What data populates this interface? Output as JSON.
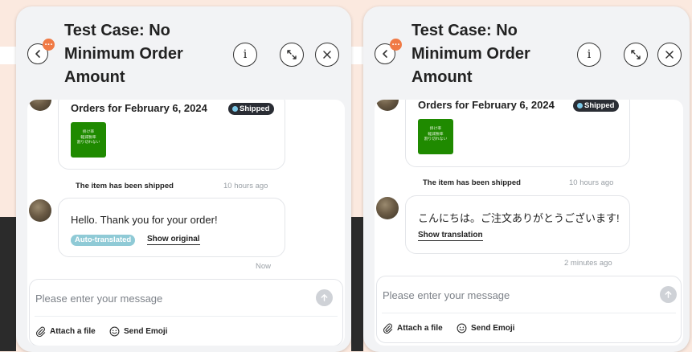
{
  "panels": [
    {
      "id": "left",
      "header": {
        "title": "Test Case: No Minimum Order Amount",
        "notification_badge": "...",
        "icons": [
          "back-icon",
          "info-icon",
          "expand-icon",
          "close-icon"
        ]
      },
      "order_card": {
        "title": "Orders for February 6, 2024",
        "status": "Shipped",
        "thumbnail_text": "掛け率\n軽減税率\n割り切れない",
        "event_text": "The item has been shipped",
        "event_time": "10 hours ago"
      },
      "message": {
        "text": "Hello. Thank you for your order!",
        "auto_translated_label": "Auto-translated",
        "toggle_label": "Show original",
        "time": "Now"
      },
      "composer": {
        "placeholder": "Please enter your message",
        "attach_label": "Attach a file",
        "emoji_label": "Send Emoji"
      }
    },
    {
      "id": "right",
      "header": {
        "title": "Test Case: No Minimum Order Amount",
        "notification_badge": "...",
        "icons": [
          "back-icon",
          "info-icon",
          "expand-icon",
          "close-icon"
        ]
      },
      "order_card": {
        "title": "Orders for February 6, 2024",
        "status": "Shipped",
        "thumbnail_text": "掛け率\n軽減税率\n割り切れない",
        "event_text": "The item has been shipped",
        "event_time": "10 hours ago"
      },
      "message": {
        "text": "こんにちは。ご注文ありがとうございます!",
        "toggle_label": "Show translation",
        "time": "2 minutes ago"
      },
      "composer": {
        "placeholder": "Please enter your message",
        "attach_label": "Attach a file",
        "emoji_label": "Send Emoji"
      }
    }
  ],
  "colors": {
    "page_background": "#fbe9df",
    "panel_background": "#f2f3f5",
    "status_badge": "#2a2d34",
    "status_dot": "#7cc8e8",
    "auto_translated_chip": "#8fcad6",
    "notification_dot": "#f07a45",
    "thumbnail_green": "#1f8a00"
  }
}
